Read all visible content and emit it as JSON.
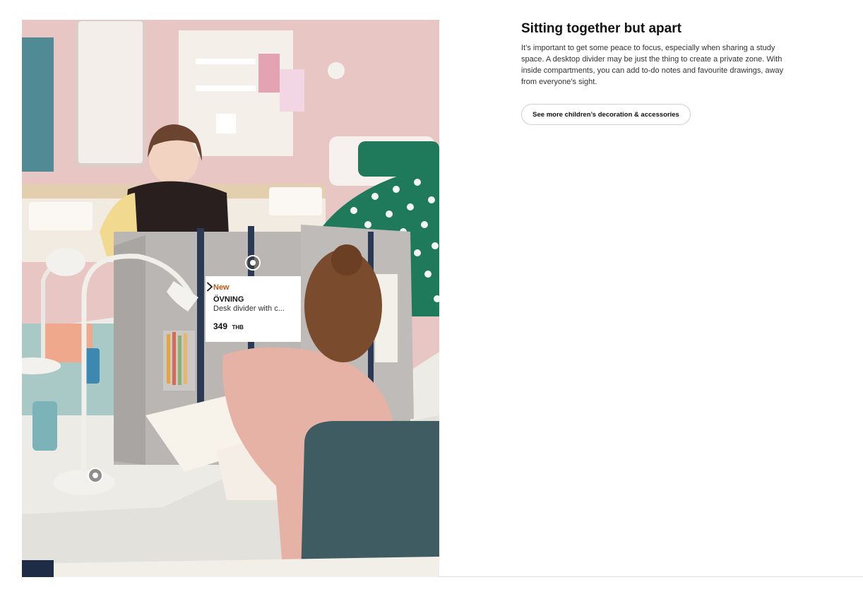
{
  "content": {
    "title": "Sitting together but apart",
    "body": "It’s important to get some peace to focus, especially when sharing a study space. A desktop divider may be just the thing to create a private zone. With inside compartments, you can add to-do notes and favourite drawings, away from everyone’s sight.",
    "cta_label": "See more children’s decoration & accessories"
  },
  "product_card": {
    "badge": "New",
    "name": "ÖVNING",
    "description": "Desk divider with c...",
    "price": "349",
    "currency": "THB"
  },
  "colors": {
    "badge": "#b35a1f",
    "wall": "#e7c6c3",
    "felt": "#b9b6b3",
    "chair": "#3f5c63",
    "bedding_green": "#1f7a5c"
  },
  "icons": {
    "card_arrow": "chevron-right-icon",
    "hotspot": "hotspot-dot-icon"
  }
}
